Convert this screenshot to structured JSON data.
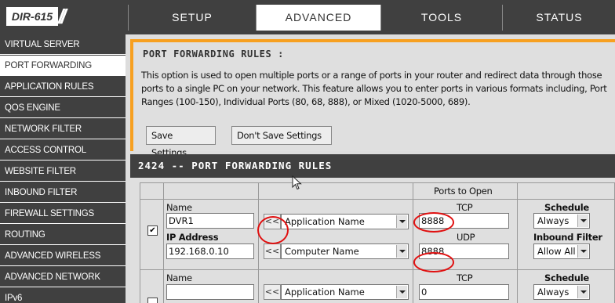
{
  "header": {
    "model": "DIR-615",
    "slashes": "//",
    "tabs": [
      {
        "label": "SETUP"
      },
      {
        "label": "ADVANCED"
      },
      {
        "label": "TOOLS"
      },
      {
        "label": "STATUS"
      }
    ]
  },
  "sidebar": {
    "items": [
      {
        "label": "VIRTUAL SERVER"
      },
      {
        "label": "PORT FORWARDING"
      },
      {
        "label": "APPLICATION RULES"
      },
      {
        "label": "QOS ENGINE"
      },
      {
        "label": "NETWORK FILTER"
      },
      {
        "label": "ACCESS CONTROL"
      },
      {
        "label": "WEBSITE FILTER"
      },
      {
        "label": "INBOUND FILTER"
      },
      {
        "label": "FIREWALL SETTINGS"
      },
      {
        "label": "ROUTING"
      },
      {
        "label": "ADVANCED WIRELESS"
      },
      {
        "label": "ADVANCED NETWORK"
      },
      {
        "label": "IPv6"
      }
    ]
  },
  "info": {
    "title": "PORT FORWARDING RULES :",
    "text": "This option is used to open multiple ports or a range of ports in your router and redirect data through those ports to a single PC on your network. This feature allows you to enter ports in various formats including, Port Ranges (100-150), Individual Ports (80, 68, 888), or Mixed (1020-5000, 689).",
    "save_label": "Save Settings",
    "dontsave_label": "Don't Save Settings"
  },
  "rules": {
    "title": "2424 -- PORT FORWARDING RULES",
    "ports_header": "Ports to Open",
    "arrow_label": "<<",
    "rows": [
      {
        "checked": true,
        "check_mark": "✔",
        "name_label": "Name",
        "name_value": "DVR1",
        "ip_label": "IP Address",
        "ip_value": "192.168.0.10",
        "app_select": "Application Name",
        "computer_select": "Computer Name",
        "tcp_label": "TCP",
        "tcp_value": "8888",
        "udp_label": "UDP",
        "udp_value": "8888",
        "schedule_label": "Schedule",
        "schedule_value": "Always",
        "inbound_label": "Inbound Filter",
        "inbound_value": "Allow All"
      },
      {
        "checked": false,
        "name_label": "Name",
        "name_value": "",
        "app_select": "Application Name",
        "tcp_label": "TCP",
        "tcp_value": "0",
        "schedule_label": "Schedule",
        "schedule_value": "Always"
      }
    ]
  },
  "colors": {
    "accent": "#f7a020",
    "dark": "#404040",
    "highlight": "#e01010"
  }
}
